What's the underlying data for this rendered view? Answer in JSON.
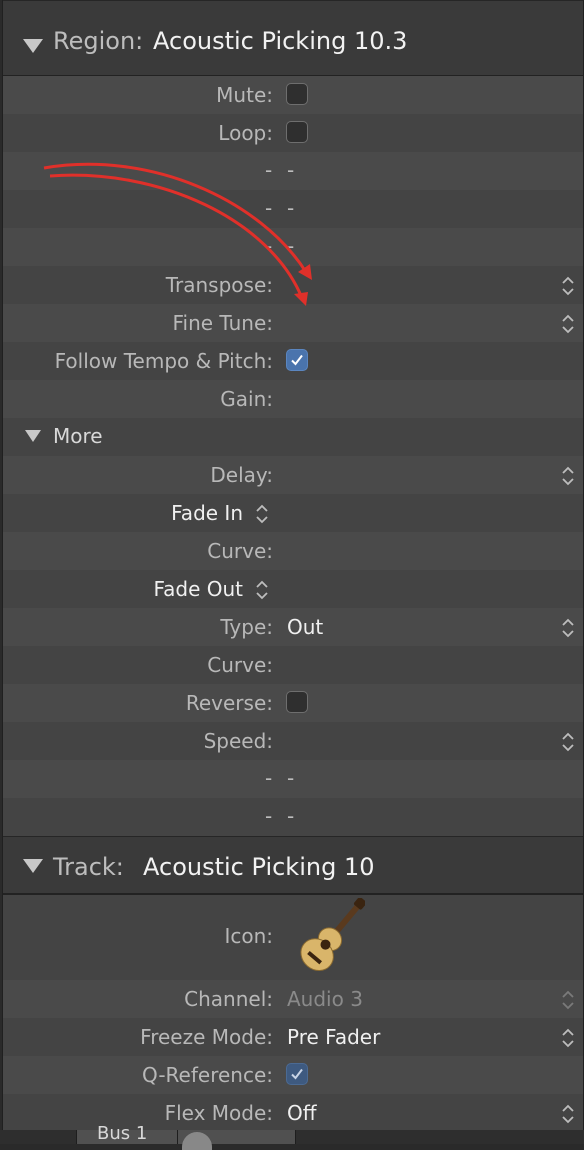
{
  "region": {
    "label": "Region:",
    "title": "Acoustic Picking 10.3",
    "mute_label": "Mute:",
    "loop_label": "Loop:",
    "dash1": "-",
    "dash2": "-",
    "transpose_label": "Transpose:",
    "finetune_label": "Fine Tune:",
    "follow_label": "Follow Tempo & Pitch:",
    "gain_label": "Gain:",
    "more_label": "More",
    "delay_label": "Delay:",
    "fadein_label": "Fade In",
    "curve_label": "Curve:",
    "fadeout_label": "Fade Out",
    "type_label": "Type:",
    "type_value": "Out",
    "reverse_label": "Reverse:",
    "speed_label": "Speed:"
  },
  "track": {
    "label": "Track:",
    "title": "Acoustic Picking 10",
    "icon_label": "Icon:",
    "icon_name": "acoustic-guitar-icon",
    "channel_label": "Channel:",
    "channel_value": "Audio 3",
    "freeze_label": "Freeze Mode:",
    "freeze_value": "Pre Fader",
    "qref_label": "Q-Reference:",
    "flex_label": "Flex Mode:",
    "flex_value": "Off"
  },
  "bottom": {
    "bus_label": "Bus 1"
  },
  "colors": {
    "panel_bg": "#444444",
    "header_bg": "#3a3a3a",
    "checkbox_on": "#4a74ad",
    "annotation_arrow": "#e0302a"
  }
}
